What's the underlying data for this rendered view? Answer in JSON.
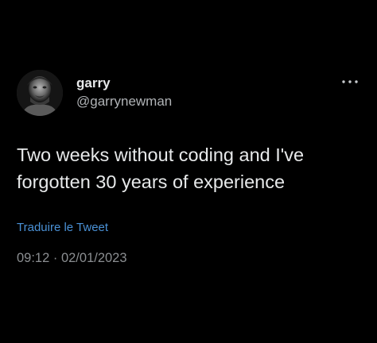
{
  "tweet": {
    "author": {
      "display_name": "garry",
      "handle": "@garrynewman"
    },
    "menu_icon": "more-horizontal-icon",
    "text": "Two weeks without coding and I've\nforgotten 30 years of experience",
    "translate_label": "Traduire le Tweet",
    "timestamp": "09:12 · 02/01/2023"
  },
  "colors": {
    "background": "#000000",
    "text": "#e7e9ea",
    "secondary_text": "#b0b3b6",
    "link": "#4a91d6",
    "timestamp": "#8b8e91"
  }
}
